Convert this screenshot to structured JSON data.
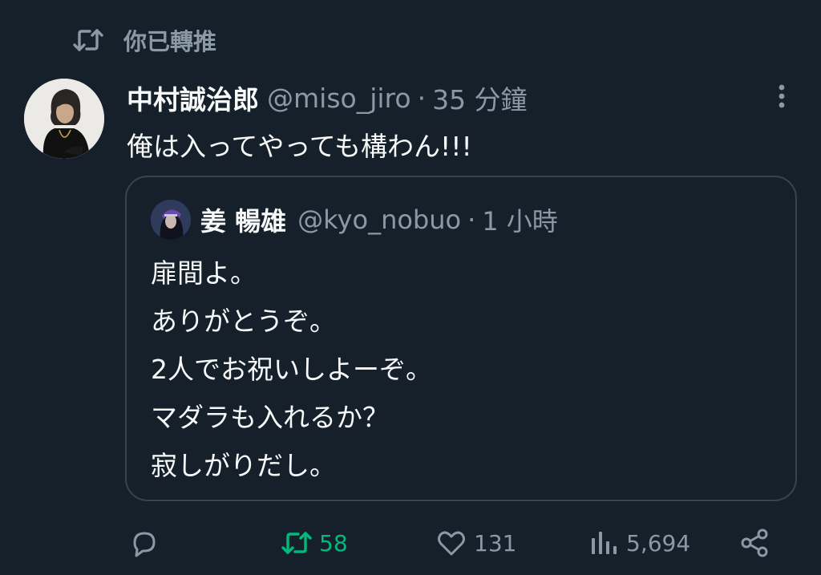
{
  "retweet_banner": {
    "icon": "retweet-icon",
    "text": "你已轉推"
  },
  "tweet": {
    "author_name": "中村誠治郎",
    "author_handle": "@miso_jiro",
    "separator": "·",
    "timestamp": "35 分鐘",
    "text": "俺は入ってやっても構わん!!!",
    "more_icon": "more-vertical-icon"
  },
  "quoted_tweet": {
    "author_name": "姜 暢雄",
    "author_handle": "@kyo_nobuo",
    "separator": "·",
    "timestamp": "1 小時",
    "lines": [
      "扉間よ。",
      "ありがとうぞ。",
      "2人でお祝いしよーぞ。",
      "マダラも入れるか？",
      "寂しがりだし。"
    ]
  },
  "actions": {
    "reply": {
      "icon": "reply-icon"
    },
    "retweet": {
      "icon": "retweet-icon",
      "count": "58",
      "active": true,
      "color": "#00ba7c"
    },
    "like": {
      "icon": "heart-icon",
      "count": "131"
    },
    "views": {
      "icon": "views-icon",
      "count": "5,694"
    },
    "share": {
      "icon": "share-icon"
    }
  },
  "colors": {
    "background": "#15202b",
    "text_primary": "#f7f9f9",
    "text_secondary": "#8b98a5",
    "border": "#38444d",
    "retweet_active": "#00ba7c"
  }
}
